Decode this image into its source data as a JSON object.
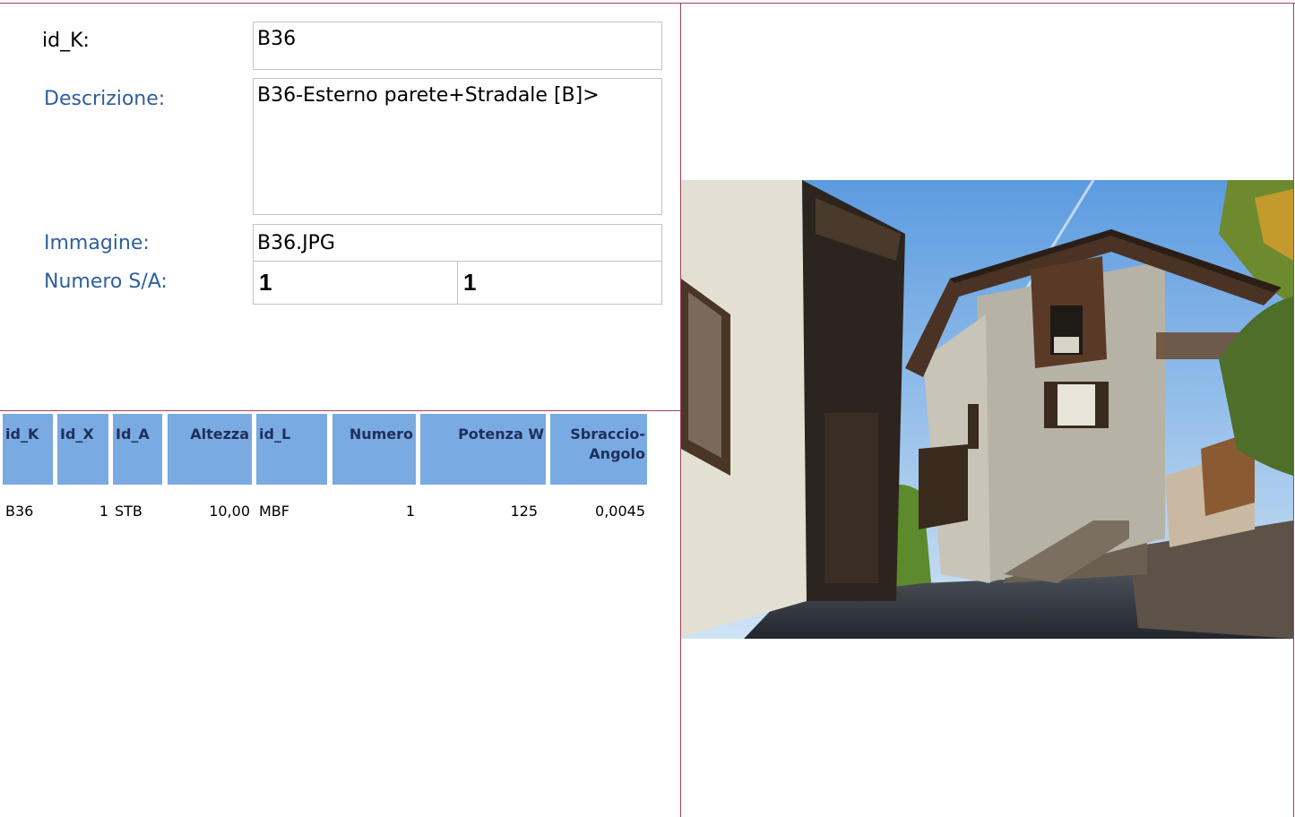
{
  "form": {
    "id_k_label": "id_K:",
    "id_k_value": "B36",
    "descrizione_label": "Descrizione:",
    "descrizione_value": "B36-Esterno parete+Stradale [B]>",
    "immagine_label": "Immagine:",
    "immagine_value": "B36.JPG",
    "numero_label": "Numero S/A:",
    "numero_s": "1",
    "numero_a": "1"
  },
  "table": {
    "headers": [
      "id_K",
      "Id_X",
      "Id_A",
      "Altezza",
      "id_L",
      "Numero",
      "Potenza W",
      "Sbraccio-Angolo"
    ],
    "rows": [
      [
        "B36",
        "1",
        "STB",
        "10,00",
        "MBF",
        "1",
        "125",
        "0,0045"
      ]
    ]
  },
  "colors": {
    "accent": "#7aaae2",
    "label_blue": "#2e5f9e",
    "border": "#a3415a"
  },
  "photo": {
    "icon": "house-photo"
  }
}
